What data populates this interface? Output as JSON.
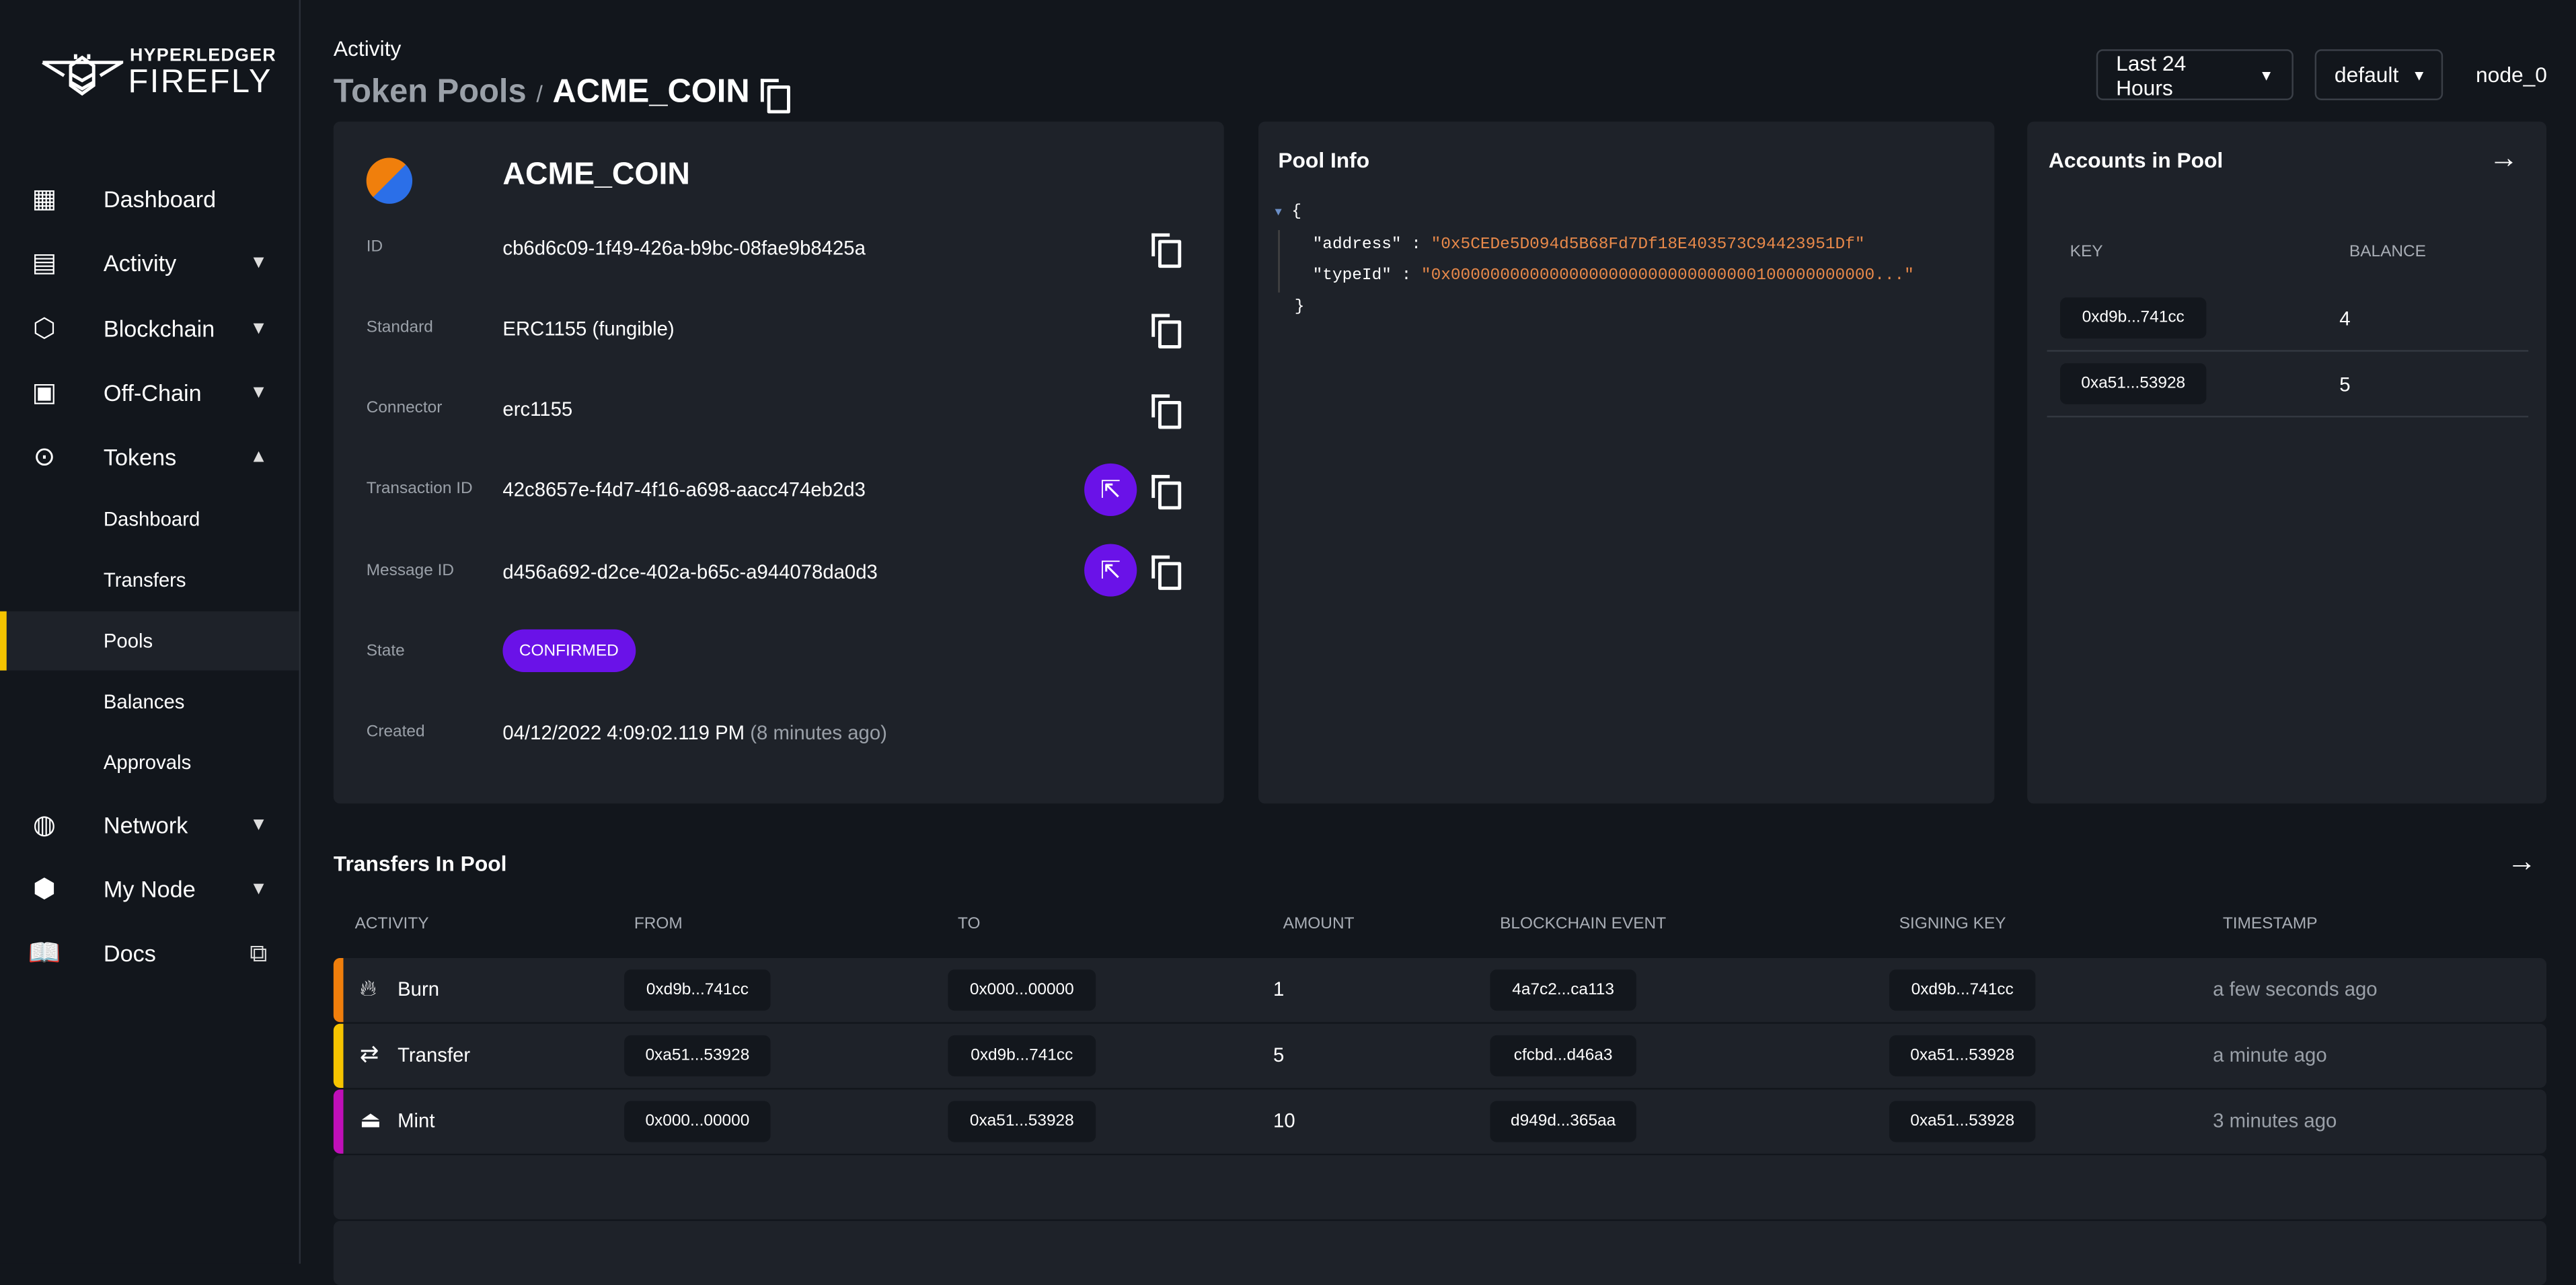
{
  "logo": {
    "line1": "HYPERLEDGER",
    "line2": "FIREFLY"
  },
  "sidebar": {
    "items": [
      {
        "label": "Dashboard",
        "icon": "dashboard-icon"
      },
      {
        "label": "Activity",
        "icon": "activity-icon"
      },
      {
        "label": "Blockchain",
        "icon": "blockchain-icon"
      },
      {
        "label": "Off-Chain",
        "icon": "archive-icon"
      },
      {
        "label": "Tokens",
        "icon": "token-icon"
      },
      {
        "label": "Network",
        "icon": "globe-icon"
      },
      {
        "label": "My Node",
        "icon": "hexagon-icon"
      },
      {
        "label": "Docs",
        "icon": "book-icon"
      }
    ],
    "token_subitems": [
      "Dashboard",
      "Transfers",
      "Pools",
      "Balances",
      "Approvals"
    ],
    "selected": "Pools"
  },
  "header": {
    "section": "Activity",
    "breadcrumb_parent": "Token Pools",
    "separator": "/",
    "title": "ACME_COIN",
    "time_filter": "Last 24 Hours",
    "namespace": "default",
    "node": "node_0"
  },
  "pool": {
    "name": "ACME_COIN",
    "fields": [
      {
        "label": "ID",
        "value": "cb6d6c09-1f49-426a-b9bc-08fae9b8425a"
      },
      {
        "label": "Standard",
        "value": "ERC1155 (fungible)"
      },
      {
        "label": "Connector",
        "value": "erc1155"
      },
      {
        "label": "Transaction ID",
        "value": "42c8657e-f4d7-4f16-a698-aacc474eb2d3"
      },
      {
        "label": "Message ID",
        "value": "d456a692-d2ce-402a-b65c-a944078da0d3"
      }
    ],
    "state_label": "State",
    "state": "CONFIRMED",
    "created_label": "Created",
    "created": "04/12/2022 4:09:02.119 PM",
    "created_relative": "(8 minutes ago)"
  },
  "pool_info": {
    "title": "Pool Info",
    "open": "{",
    "close": "}",
    "entries": [
      {
        "key": "\"address\"",
        "value": "\"0x5CEDe5D094d5B68Fd7Df18E403573C94423951Df\""
      },
      {
        "key": "\"typeId\"",
        "value": "\"0x0000000000000000000000000000000100000000000...\""
      }
    ]
  },
  "accounts": {
    "title": "Accounts in Pool",
    "headers": [
      "KEY",
      "BALANCE"
    ],
    "rows": [
      {
        "key": "0xd9b...741cc",
        "balance": "4"
      },
      {
        "key": "0xa51...53928",
        "balance": "5"
      }
    ]
  },
  "transfers": {
    "title": "Transfers In Pool",
    "headers": [
      "ACTIVITY",
      "FROM",
      "TO",
      "AMOUNT",
      "BLOCKCHAIN EVENT",
      "SIGNING KEY",
      "TIMESTAMP"
    ],
    "rows": [
      {
        "activity": "Burn",
        "icon": "fire-icon",
        "color": "#f07f0c",
        "from": "0xd9b...741cc",
        "to": "0x000...00000",
        "amount": "1",
        "event": "4a7c2...ca113",
        "key": "0xd9b...741cc",
        "time": "a few seconds ago"
      },
      {
        "activity": "Transfer",
        "icon": "swap-icon",
        "color": "#f5c400",
        "from": "0xa51...53928",
        "to": "0xd9b...741cc",
        "amount": "5",
        "event": "cfcbd...d46a3",
        "key": "0xa51...53928",
        "time": "a minute ago"
      },
      {
        "activity": "Mint",
        "icon": "stamp-icon",
        "color": "#c00fb8",
        "from": "0x000...00000",
        "to": "0xa51...53928",
        "amount": "10",
        "event": "d949d...365aa",
        "key": "0xa51...53928",
        "time": "3 minutes ago"
      }
    ]
  },
  "colors": {
    "accent": "#6a12e8",
    "selected": "#f5c400",
    "json_value": "#e8894a"
  }
}
